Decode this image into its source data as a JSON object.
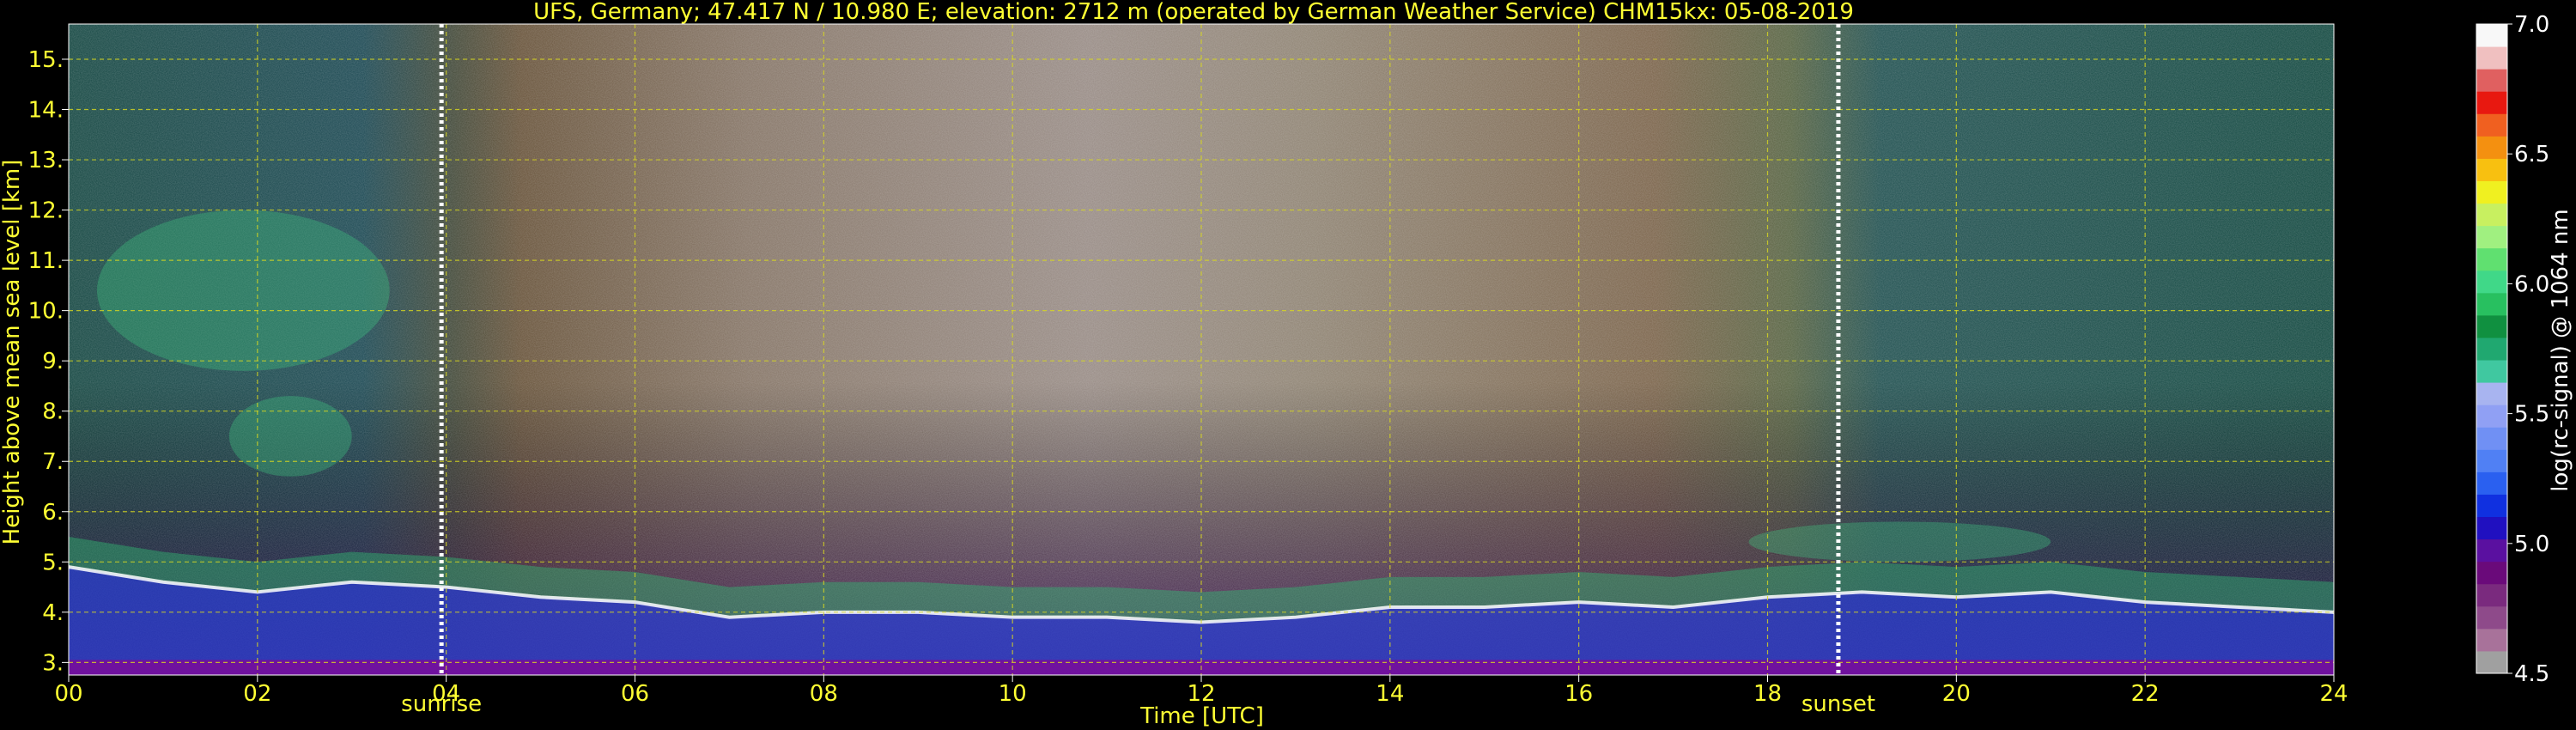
{
  "chart_data": {
    "type": "heatmap",
    "title": "UFS, Germany; 47.417 N / 10.980 E; elevation: 2712 m  (operated by German Weather Service)    CHM15kx: 05-08-2019",
    "xlabel": "Time [UTC]",
    "ylabel": "Height above mean sea level [km]",
    "xlim": [
      0,
      24
    ],
    "ylim": [
      2.75,
      15.7
    ],
    "x_ticks": [
      {
        "v": 0,
        "label": "00"
      },
      {
        "v": 2,
        "label": "02"
      },
      {
        "v": 4,
        "label": "04"
      },
      {
        "v": 6,
        "label": "06"
      },
      {
        "v": 8,
        "label": "08"
      },
      {
        "v": 10,
        "label": "10"
      },
      {
        "v": 12,
        "label": "12"
      },
      {
        "v": 14,
        "label": "14"
      },
      {
        "v": 16,
        "label": "16"
      },
      {
        "v": 18,
        "label": "18"
      },
      {
        "v": 20,
        "label": "20"
      },
      {
        "v": 22,
        "label": "22"
      },
      {
        "v": 24,
        "label": "24"
      }
    ],
    "y_ticks": [
      {
        "v": 3,
        "label": "3."
      },
      {
        "v": 4,
        "label": "4."
      },
      {
        "v": 5,
        "label": "5."
      },
      {
        "v": 6,
        "label": "6."
      },
      {
        "v": 7,
        "label": "7."
      },
      {
        "v": 8,
        "label": "8."
      },
      {
        "v": 9,
        "label": "9."
      },
      {
        "v": 10,
        "label": "10."
      },
      {
        "v": 11,
        "label": "11."
      },
      {
        "v": 12,
        "label": "12."
      },
      {
        "v": 13,
        "label": "13."
      },
      {
        "v": 14,
        "label": "14."
      },
      {
        "v": 15,
        "label": "15."
      }
    ],
    "grid": true,
    "events": [
      {
        "name": "sunrise",
        "x": 3.95
      },
      {
        "name": "sunset",
        "x": 18.75
      }
    ],
    "colorbar": {
      "label": "log(rc-signal) @ 1064 nm",
      "range": [
        4.5,
        7.0
      ],
      "ticks": [
        {
          "v": 4.5,
          "label": "4.5"
        },
        {
          "v": 5.0,
          "label": "5.0"
        },
        {
          "v": 5.5,
          "label": "5.5"
        },
        {
          "v": 6.0,
          "label": "6.0"
        },
        {
          "v": 6.5,
          "label": "6.5"
        },
        {
          "v": 7.0,
          "label": "7.0"
        }
      ],
      "colors": [
        "#a0a0a0",
        "#a8729a",
        "#8e4a8a",
        "#7a2a7e",
        "#6a0a7a",
        "#5a10a0",
        "#2010c0",
        "#1030e0",
        "#2a60f0",
        "#5080f4",
        "#7090f4",
        "#90a0f4",
        "#a8b4f0",
        "#40c8a0",
        "#20a870",
        "#109040",
        "#28c060",
        "#40d888",
        "#60e070",
        "#a0f080",
        "#c8f060",
        "#f0f020",
        "#f8c010",
        "#f49010",
        "#f06020",
        "#e81810",
        "#e06060",
        "#f0c0c0",
        "#f8f8f8"
      ]
    },
    "features": [
      {
        "name": "boundary layer / aerosol top",
        "x": [
          0,
          1,
          2,
          3,
          4,
          5,
          6,
          7,
          8,
          9,
          10,
          11,
          12,
          13,
          14,
          15,
          16,
          17,
          18,
          19,
          20,
          21,
          22,
          23,
          24
        ],
        "y_top": [
          4.9,
          4.6,
          4.4,
          4.6,
          4.5,
          4.3,
          4.2,
          3.9,
          4.0,
          4.0,
          3.9,
          3.9,
          3.8,
          3.9,
          4.1,
          4.1,
          4.2,
          4.1,
          4.3,
          4.4,
          4.3,
          4.4,
          4.2,
          4.1,
          4.0
        ]
      },
      {
        "name": "cirrus cloud",
        "x_range": [
          0.3,
          3.4
        ],
        "y_range": [
          8.8,
          12.0
        ]
      },
      {
        "name": "mid-level cloud",
        "x_range": [
          1.7,
          3.0
        ],
        "y_range": [
          6.7,
          8.3
        ]
      },
      {
        "name": "cloud layer",
        "x_range": [
          17.8,
          21.0
        ],
        "y_range": [
          5.0,
          5.8
        ]
      }
    ],
    "colors": {
      "text": "#ffff33",
      "grid": "#d8d820",
      "background": "#000000",
      "event_line": "#ffffff"
    }
  }
}
